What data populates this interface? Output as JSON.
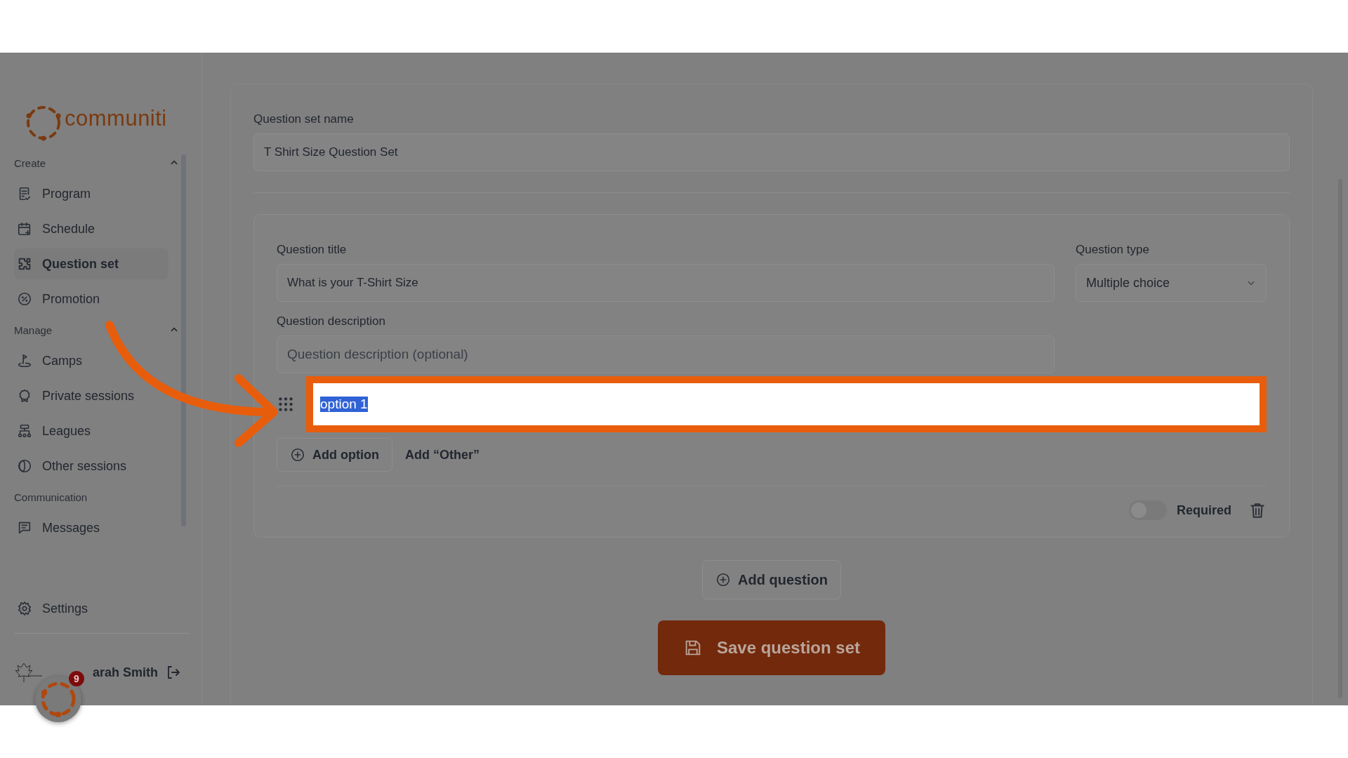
{
  "sidebar": {
    "logo": "communiti",
    "sections": [
      {
        "title": "Create",
        "expanded": true,
        "items": [
          {
            "label": "Program",
            "selected": false
          },
          {
            "label": "Schedule",
            "selected": false
          },
          {
            "label": "Question set",
            "selected": true
          },
          {
            "label": "Promotion",
            "selected": false
          }
        ]
      },
      {
        "title": "Manage",
        "expanded": true,
        "items": [
          {
            "label": "Camps",
            "selected": false
          },
          {
            "label": "Private sessions",
            "selected": false
          },
          {
            "label": "Leagues",
            "selected": false
          },
          {
            "label": "Other sessions",
            "selected": false
          }
        ]
      },
      {
        "title": "Communication",
        "items": [
          {
            "label": "Messages",
            "selected": false
          }
        ]
      }
    ],
    "settings": "Settings",
    "user": "arah Smith",
    "notification_badge": "9"
  },
  "form": {
    "name_label": "Question set name",
    "name_value": "T Shirt Size Question Set",
    "question": {
      "title_label": "Question title",
      "title_value": "What is your T-Shirt Size",
      "type_label": "Question type",
      "type_value": "Multiple choice",
      "description_label": "Question description",
      "description_placeholder": "Question description (optional)",
      "options": [
        {
          "value": "option 1",
          "text_selected": true,
          "highlighted": true
        }
      ],
      "add_option": "Add option",
      "add_other": "Add “Other”",
      "required": {
        "label": "Required",
        "on": false
      }
    },
    "add_question": "Add question",
    "save": "Save question set"
  }
}
